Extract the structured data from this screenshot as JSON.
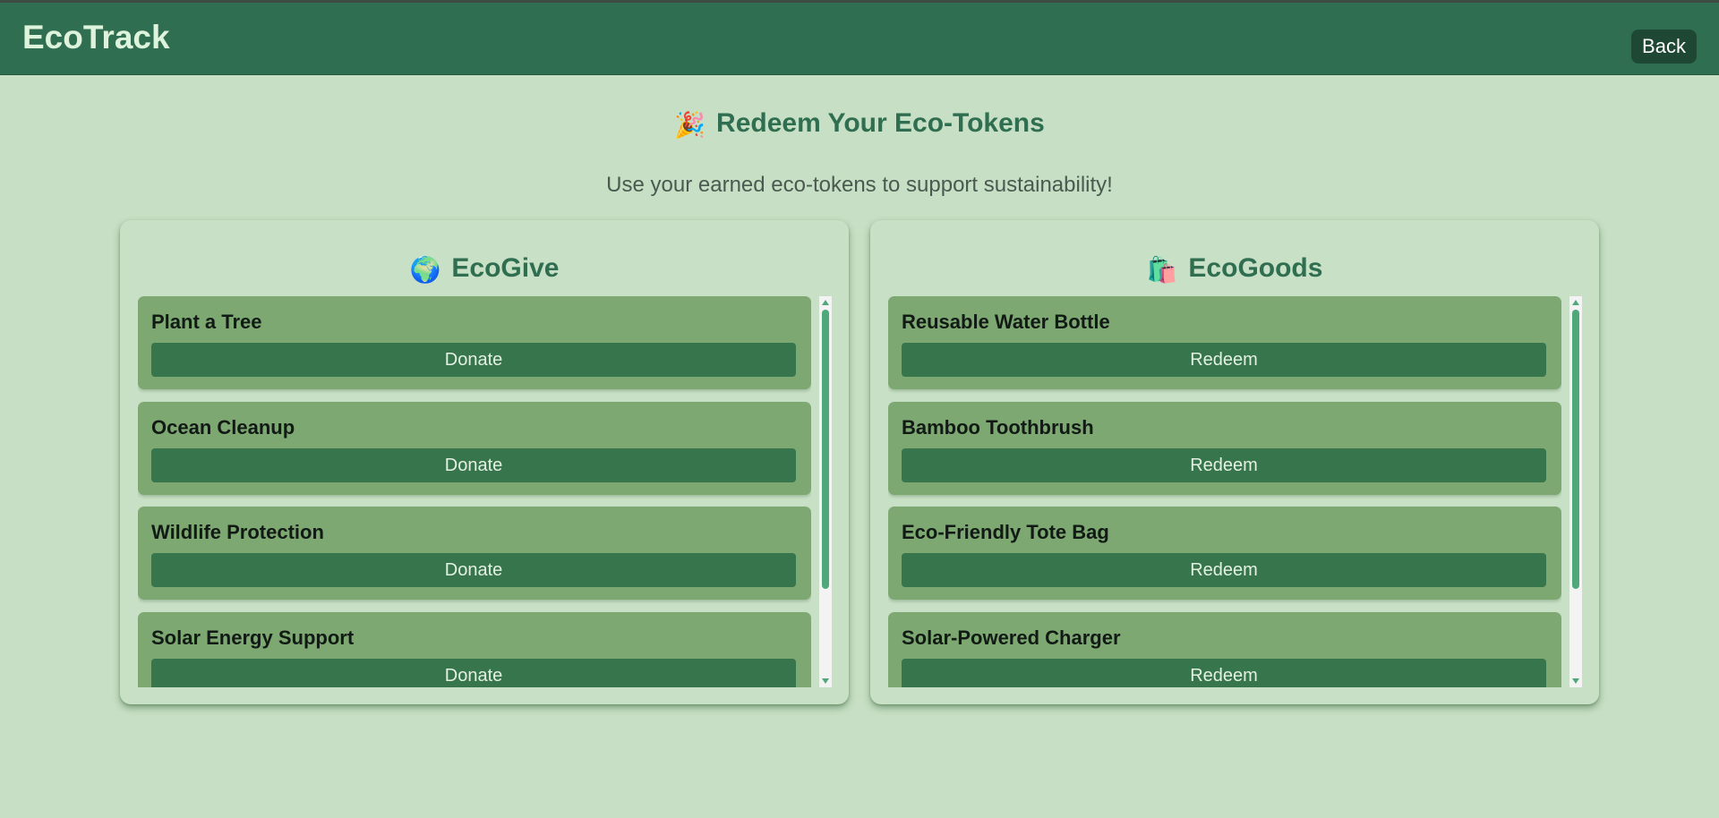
{
  "header": {
    "app_title": "EcoTrack",
    "back_label": "Back"
  },
  "main": {
    "title": "Redeem Your Eco-Tokens",
    "title_icon": "🎉",
    "subtitle": "Use your earned eco-tokens to support sustainability!"
  },
  "ecogive": {
    "title": "EcoGive",
    "icon": "🌍",
    "items": [
      {
        "name": "Plant a Tree",
        "action": "Donate"
      },
      {
        "name": "Ocean Cleanup",
        "action": "Donate"
      },
      {
        "name": "Wildlife Protection",
        "action": "Donate"
      },
      {
        "name": "Solar Energy Support",
        "action": "Donate"
      }
    ]
  },
  "ecogoods": {
    "title": "EcoGoods",
    "icon": "🛍️",
    "items": [
      {
        "name": "Reusable Water Bottle",
        "action": "Redeem"
      },
      {
        "name": "Bamboo Toothbrush",
        "action": "Redeem"
      },
      {
        "name": "Eco-Friendly Tote Bag",
        "action": "Redeem"
      },
      {
        "name": "Solar-Powered Charger",
        "action": "Redeem"
      }
    ]
  },
  "colors": {
    "background": "#c7dfc4",
    "header": "#2f6e50",
    "accent": "#2f6e50",
    "card": "#7da872",
    "button": "#37754c",
    "scrollbar_thumb": "#4fa87a"
  }
}
